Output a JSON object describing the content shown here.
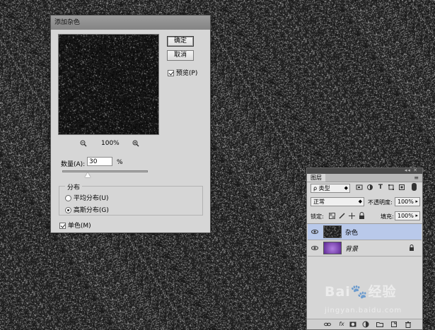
{
  "colors": {
    "canvas_bg": "#1d1d1d",
    "dialog_bg": "#d6d6d6",
    "selected_layer": "#b9c9ea",
    "layer_bg_purple": "#7b3fb0"
  },
  "dialog": {
    "title": "添加杂色",
    "ok_label": "确定",
    "cancel_label": "取消",
    "preview_label": "预览(P)",
    "preview_checked": true,
    "zoom_level": "100%",
    "zoom_out_icon": "zoom-out-icon",
    "zoom_in_icon": "zoom-in-icon",
    "amount_label": "数量(A):",
    "amount_value": "30",
    "amount_unit": "%",
    "amount_fraction": 0.3,
    "distribution": {
      "legend": "分布",
      "options": [
        {
          "label": "平均分布(U)",
          "checked": false
        },
        {
          "label": "高斯分布(G)",
          "checked": true
        }
      ]
    },
    "monochrome_label": "单色(M)",
    "monochrome_checked": true
  },
  "layers_panel": {
    "tab_label": "图层",
    "kind_filter": "ρ 类型",
    "blend_mode": "正常",
    "opacity_label": "不透明度:",
    "opacity_value": "100%",
    "lock_label": "锁定:",
    "fill_label": "填充:",
    "fill_value": "100%",
    "layers": [
      {
        "name": "杂色",
        "selected": true,
        "visible": true,
        "locked": false
      },
      {
        "name": "背景",
        "selected": false,
        "visible": true,
        "locked": true
      }
    ]
  },
  "watermark": {
    "brand": "Bai",
    "brand_suffix": "经验",
    "sub": "jingyan.baidu.com"
  }
}
